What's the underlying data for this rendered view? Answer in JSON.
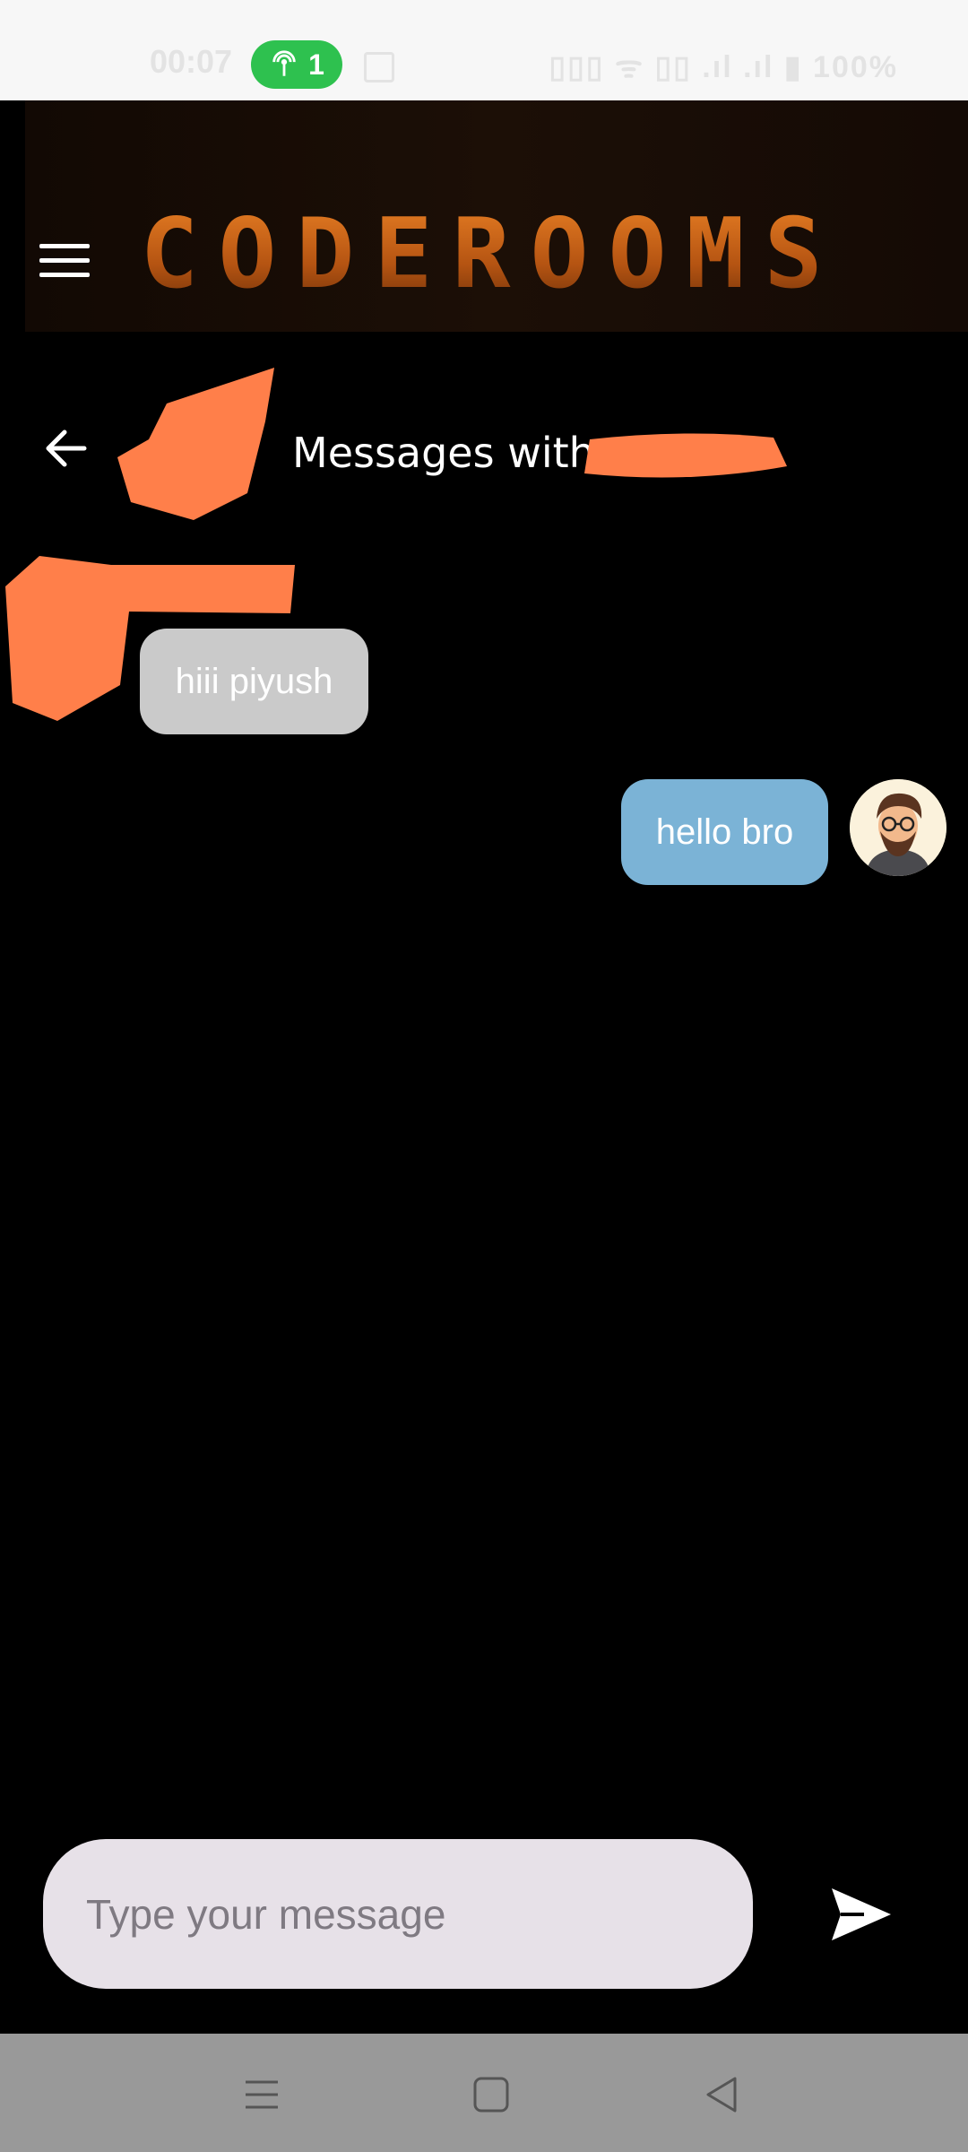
{
  "status_bar": {
    "time": "00:07",
    "hotspot_count": "1",
    "right_text": "▯▯▯ ᯤ ▯▯ .ıl .ıl ▮ 100%"
  },
  "header": {
    "brand": "CODEROOMS"
  },
  "conversation": {
    "title_prefix": "Messages with"
  },
  "messages": [
    {
      "direction": "incoming",
      "text": "hiii piyush"
    },
    {
      "direction": "outgoing",
      "text": "hello bro"
    }
  ],
  "composer": {
    "placeholder": "Type your message"
  },
  "colors": {
    "accent": "#d96e1a",
    "incoming_bubble": "#cacaca",
    "outgoing_bubble": "#7bb3d6",
    "redaction": "#ff7f4a",
    "input_bg": "#e7e1e8"
  }
}
